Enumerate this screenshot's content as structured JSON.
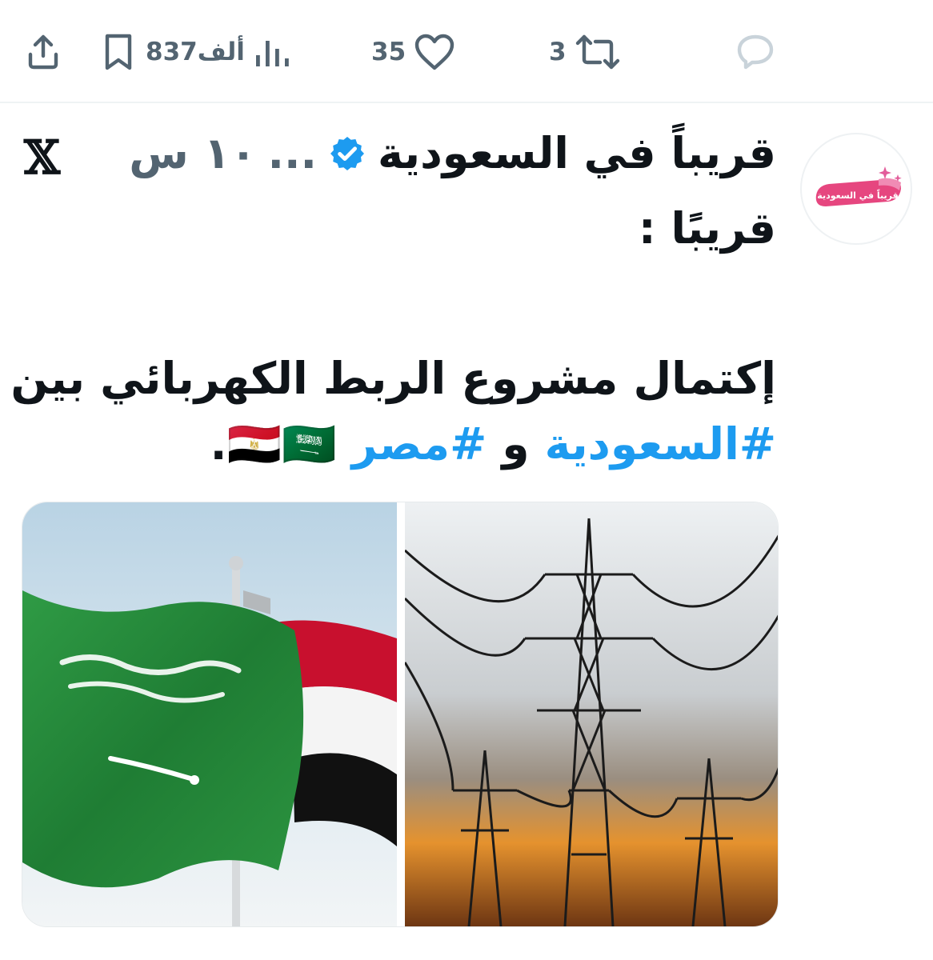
{
  "actions": {
    "share_icon": "share-icon",
    "bookmark_icon": "bookmark-icon",
    "views_icon": "views-icon",
    "views_count": "837ألف",
    "likes_icon": "heart-icon",
    "likes_count": "35",
    "retweets_icon": "retweet-icon",
    "retweets_count": "3",
    "reply_icon": "reply-icon"
  },
  "tweet": {
    "display_name": "قريباً في السعودية",
    "ellipsis": "...",
    "time": "١٠ س",
    "handle_line": "قريبًا :",
    "text_main": "إكتمال مشروع الربط الكهربائي بين",
    "hashtag_1": "#السعودية",
    "connector": " و ",
    "hashtag_2": "#مصر",
    "flags": "🇪🇬🇸🇦.",
    "avatar_text": "قريباً في السعودية"
  },
  "colors": {
    "accent": "#1d9bf0",
    "muted": "#536471",
    "text": "#0f1419",
    "separator": "#eff3f4"
  }
}
